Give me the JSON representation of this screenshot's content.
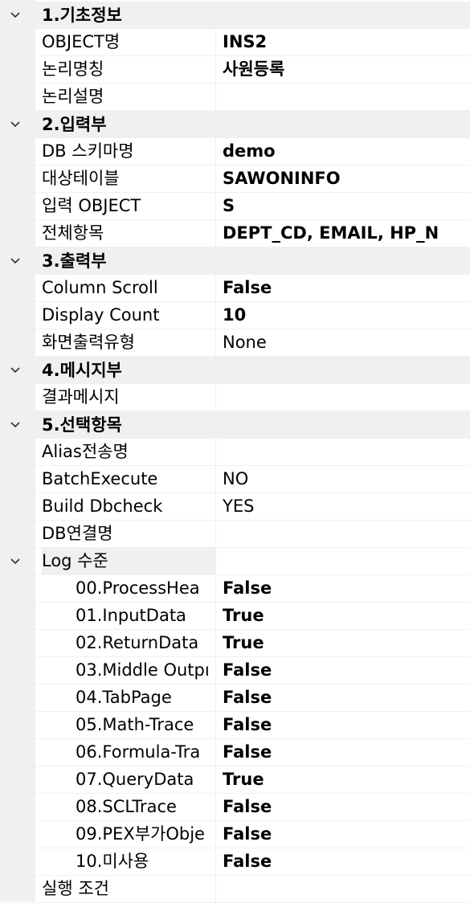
{
  "sections": [
    {
      "title": "1.기초정보",
      "rows": [
        {
          "name": "OBJECT명",
          "value": "INS2",
          "bold": true
        },
        {
          "name": "논리명칭",
          "value": "사원등록",
          "bold": true
        },
        {
          "name": "논리설명",
          "value": "",
          "bold": false
        }
      ]
    },
    {
      "title": "2.입력부",
      "rows": [
        {
          "name": "DB 스키마명",
          "value": "demo",
          "bold": true
        },
        {
          "name": "대상테이블",
          "value": "SAWONINFO",
          "bold": true
        },
        {
          "name": "입력 OBJECT",
          "value": "S",
          "bold": true
        },
        {
          "name": "전체항목",
          "value": "DEPT_CD, EMAIL, HP_N",
          "bold": true
        }
      ]
    },
    {
      "title": "3.출력부",
      "rows": [
        {
          "name": "Column Scroll",
          "value": "False",
          "bold": true
        },
        {
          "name": "Display Count",
          "value": "10",
          "bold": true
        },
        {
          "name": "화면출력유형",
          "value": "None",
          "bold": false
        }
      ]
    },
    {
      "title": "4.메시지부",
      "rows": [
        {
          "name": "결과메시지",
          "value": "",
          "bold": false
        }
      ]
    },
    {
      "title": "5.선택항목",
      "rows": [
        {
          "name": "Alias전송명",
          "value": "",
          "bold": false
        },
        {
          "name": "BatchExecute",
          "value": "NO",
          "bold": false
        },
        {
          "name": "Build Dbcheck",
          "value": "YES",
          "bold": false
        },
        {
          "name": "DB연결명",
          "value": "",
          "bold": false
        }
      ]
    }
  ],
  "log": {
    "title": "Log 수준",
    "rows": [
      {
        "name": "00.ProcessHea",
        "value": "False"
      },
      {
        "name": "01.InputData",
        "value": "True"
      },
      {
        "name": "02.ReturnData",
        "value": "True"
      },
      {
        "name": "03.Middle Outpı",
        "value": "False"
      },
      {
        "name": "04.TabPage",
        "value": "False"
      },
      {
        "name": "05.Math-Trace",
        "value": "False"
      },
      {
        "name": "06.Formula-Tra",
        "value": "False"
      },
      {
        "name": "07.QueryData",
        "value": "True"
      },
      {
        "name": "08.SCLTrace",
        "value": "False"
      },
      {
        "name": "09.PEX부가Obje",
        "value": "False"
      },
      {
        "name": "10.미사용",
        "value": "False"
      }
    ]
  },
  "last": {
    "name": "실행 조건",
    "value": ""
  },
  "icons": {
    "expand": "chevron-down-icon"
  },
  "colors": {
    "category_bg": "#f0f0f0",
    "grid_line": "#f0f0f0"
  }
}
